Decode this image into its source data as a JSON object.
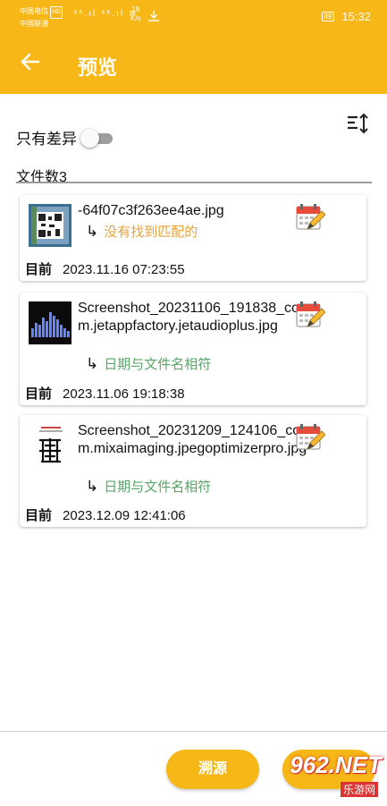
{
  "statusbar": {
    "carrier1": "中国电信",
    "carrier2": "中国联通",
    "hd": "HD",
    "signal_icons": "⁴⁶.ıl ⁴⁶.ıl ≋",
    "speed_value": "18",
    "speed_unit": "K/s",
    "battery": "89",
    "time": "15:32"
  },
  "header": {
    "title": "预览",
    "back_icon": "arrow-left-icon"
  },
  "toolbar": {
    "diff_only_label": "只有差异",
    "diff_only_enabled": false,
    "sort_icon": "sort-icon",
    "file_count_label": "文件数3"
  },
  "files": [
    {
      "name": "-64f07c3f263ee4ae.jpg",
      "status": "没有找到匹配的",
      "status_color": "#e6a23c",
      "current_label": "目前",
      "current_value": "2023.11.16 07:23:55"
    },
    {
      "name": "Screenshot_20231106_191838_com.jetappfactory.jetaudioplus.jpg",
      "status": "日期与文件名相符",
      "status_color": "#5aa469",
      "current_label": "目前",
      "current_value": "2023.11.06 19:18:38"
    },
    {
      "name": "Screenshot_20231209_124106_com.mixaimaging.jpegoptimizerpro.jpg",
      "status": "日期与文件名相符",
      "status_color": "#5aa469",
      "current_label": "目前",
      "current_value": "2023.12.09 12:41:06"
    }
  ],
  "bottom": {
    "trace_label": "溯源"
  },
  "watermark": {
    "main": "962.NET",
    "sub": "乐游网"
  },
  "colors": {
    "accent": "#f6b717",
    "match": "#5aa469",
    "nomatch": "#e6a23c"
  }
}
